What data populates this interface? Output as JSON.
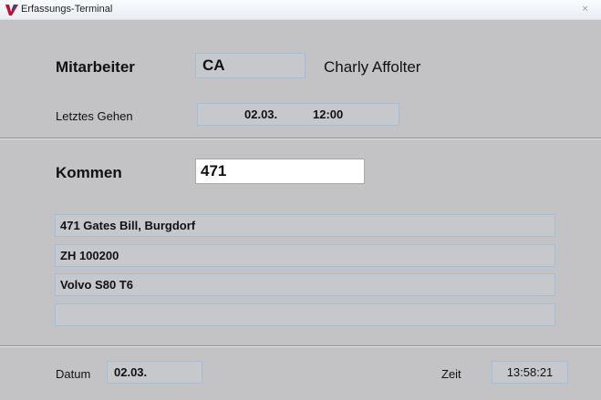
{
  "window": {
    "title": "Erfassungs-Terminal",
    "close_glyph": "×",
    "logo_icon": "app-logo-icon",
    "accent": "#c4102f"
  },
  "employee": {
    "label": "Mitarbeiter",
    "code": "CA",
    "name": "Charly Affolter"
  },
  "last_leave": {
    "label": "Letztes Gehen",
    "date": "02.03.",
    "time": "12:00"
  },
  "arrival": {
    "label": "Kommen",
    "input_value": "471"
  },
  "details": {
    "lines": [
      "471 Gates Bill, Burgdorf",
      "ZH 100200",
      "Volvo S80 T6",
      ""
    ]
  },
  "footer": {
    "date_label": "Datum",
    "date_value": "02.03.",
    "time_label": "Zeit",
    "time_value": "13:58:21"
  }
}
